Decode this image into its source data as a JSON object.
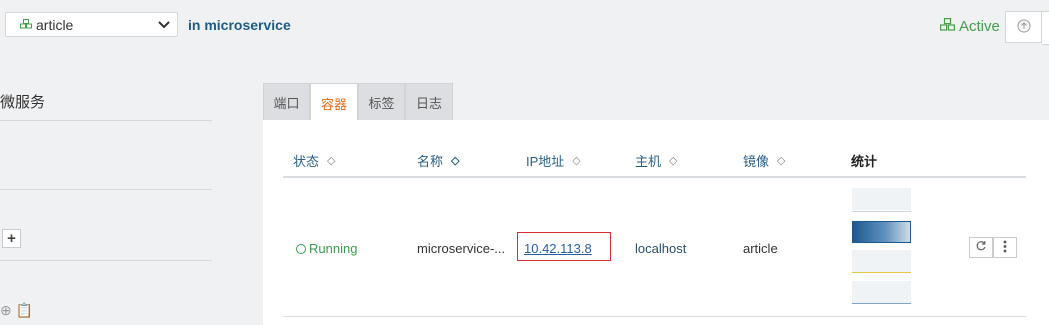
{
  "header": {
    "service_name": "article",
    "stack_label": "in microservice",
    "state": "Active",
    "icons": {
      "service": "cubes-icon",
      "select": "chevron-down-icon",
      "state": "cubes-icon",
      "upgrade": "arrow-up-circle-icon"
    }
  },
  "sidebar": {
    "title": "微服务",
    "add_symbol": "+",
    "bottom_glyphs": "⊕ 📋"
  },
  "tabs": [
    {
      "label": "端口"
    },
    {
      "label": "容器"
    },
    {
      "label": "标签"
    },
    {
      "label": "日志"
    }
  ],
  "table": {
    "columns": [
      {
        "label": "状态",
        "sort": "◇"
      },
      {
        "label": "名称",
        "sort": "◇"
      },
      {
        "label": "IP地址",
        "sort": "◇"
      },
      {
        "label": "主机",
        "sort": "◇"
      },
      {
        "label": "镜像",
        "sort": "◇"
      },
      {
        "label": "统计"
      }
    ],
    "rows": [
      {
        "status": "Running",
        "name": "microservice-...",
        "ip": "10.42.113.8",
        "host": "localhost",
        "image": "article"
      }
    ],
    "row_actions": {
      "restart_icon": "restart-icon",
      "menu_icon": "vertical-dots-icon"
    }
  },
  "colors": {
    "accent": "#1e5c86",
    "active": "#45a049",
    "active_tab": "#e36f1e",
    "running": "#3a9c4f",
    "highlight_border": "#d3302f",
    "link": "#2a5da8"
  }
}
